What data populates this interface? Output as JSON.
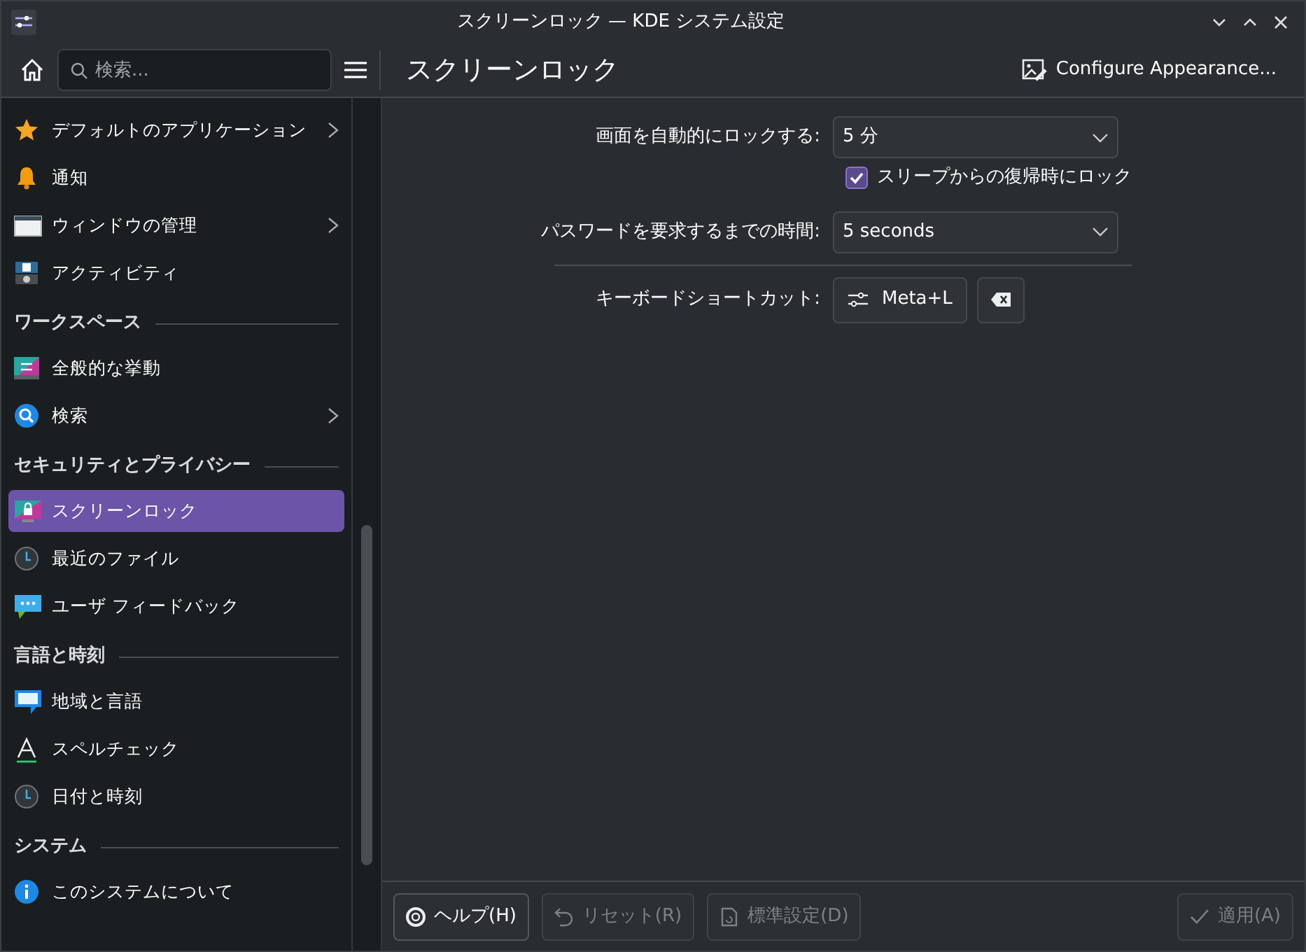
{
  "window": {
    "title": "スクリーンロック — KDE システム設定"
  },
  "toolbar": {
    "search": {
      "placeholder": "検索..."
    },
    "page_title": "スクリーンロック",
    "appearance_button": "Configure Appearance..."
  },
  "sidebar": {
    "items": [
      {
        "kind": "item",
        "label": "デフォルトのアプリケーション",
        "has_children": true,
        "selected": false
      },
      {
        "kind": "item",
        "label": "通知",
        "has_children": false,
        "selected": false
      },
      {
        "kind": "item",
        "label": "ウィンドウの管理",
        "has_children": true,
        "selected": false
      },
      {
        "kind": "item",
        "label": "アクティビティ",
        "has_children": false,
        "selected": false
      },
      {
        "kind": "header",
        "label": "ワークスペース"
      },
      {
        "kind": "item",
        "label": "全般的な挙動",
        "has_children": false,
        "selected": false
      },
      {
        "kind": "item",
        "label": "検索",
        "has_children": true,
        "selected": false
      },
      {
        "kind": "header",
        "label": "セキュリティとプライバシー"
      },
      {
        "kind": "item",
        "label": "スクリーンロック",
        "has_children": false,
        "selected": true
      },
      {
        "kind": "item",
        "label": "最近のファイル",
        "has_children": false,
        "selected": false
      },
      {
        "kind": "item",
        "label": "ユーザ フィードバック",
        "has_children": false,
        "selected": false
      },
      {
        "kind": "header",
        "label": "言語と時刻"
      },
      {
        "kind": "item",
        "label": "地域と言語",
        "has_children": false,
        "selected": false
      },
      {
        "kind": "item",
        "label": "スペルチェック",
        "has_children": false,
        "selected": false
      },
      {
        "kind": "item",
        "label": "日付と時刻",
        "has_children": false,
        "selected": false
      },
      {
        "kind": "header",
        "label": "システム"
      },
      {
        "kind": "item",
        "label": "このシステムについて",
        "has_children": false,
        "selected": false
      }
    ]
  },
  "form": {
    "rows": [
      {
        "kind": "combo",
        "label": "画面を自動的にロックする:",
        "value": "5 分"
      },
      {
        "kind": "checkbox",
        "label": "スリープからの復帰時にロック",
        "checked": true
      },
      {
        "kind": "combo",
        "label": "パスワードを要求するまでの時間:",
        "value": "5 seconds"
      },
      {
        "kind": "separator"
      },
      {
        "kind": "shortcut",
        "label": "キーボードショートカット:",
        "value": "Meta+L"
      }
    ]
  },
  "footer": {
    "buttons": [
      {
        "kind": "help",
        "label": "ヘルプ(H)",
        "disabled": false
      },
      {
        "kind": "reset",
        "label": "リセット(R)",
        "disabled": true
      },
      {
        "kind": "defaults",
        "label": "標準設定(D)",
        "disabled": true
      },
      {
        "kind": "apply",
        "label": "適用(A)",
        "disabled": true
      }
    ]
  }
}
